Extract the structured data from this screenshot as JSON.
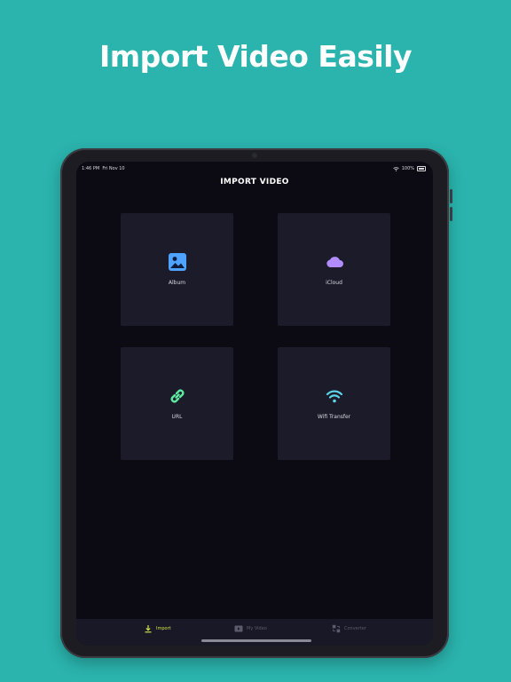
{
  "headline": "Import Video Easily",
  "status_bar": {
    "time": "1:46 PM",
    "date": "Fri Nov 10",
    "battery": "100%"
  },
  "screen_title": "IMPORT VIDEO",
  "tiles": [
    {
      "label": "Album",
      "icon": "photo-album-icon",
      "color": "#4da3ff"
    },
    {
      "label": "iCloud",
      "icon": "cloud-icon",
      "color": "#b08cff"
    },
    {
      "label": "URL",
      "icon": "link-icon",
      "color": "#5ee8a0"
    },
    {
      "label": "Wifi Transfer",
      "icon": "wifi-icon",
      "color": "#5fd3e8"
    }
  ],
  "tabs": [
    {
      "label": "Import",
      "icon": "download-icon",
      "active": true
    },
    {
      "label": "My Video",
      "icon": "video-play-icon",
      "active": false
    },
    {
      "label": "Converter",
      "icon": "converter-icon",
      "active": false
    }
  ],
  "colors": {
    "background": "#2bb3ad",
    "screen": "#0c0b14",
    "tile": "#1b1b2a",
    "active_tab": "#d4e34a"
  }
}
